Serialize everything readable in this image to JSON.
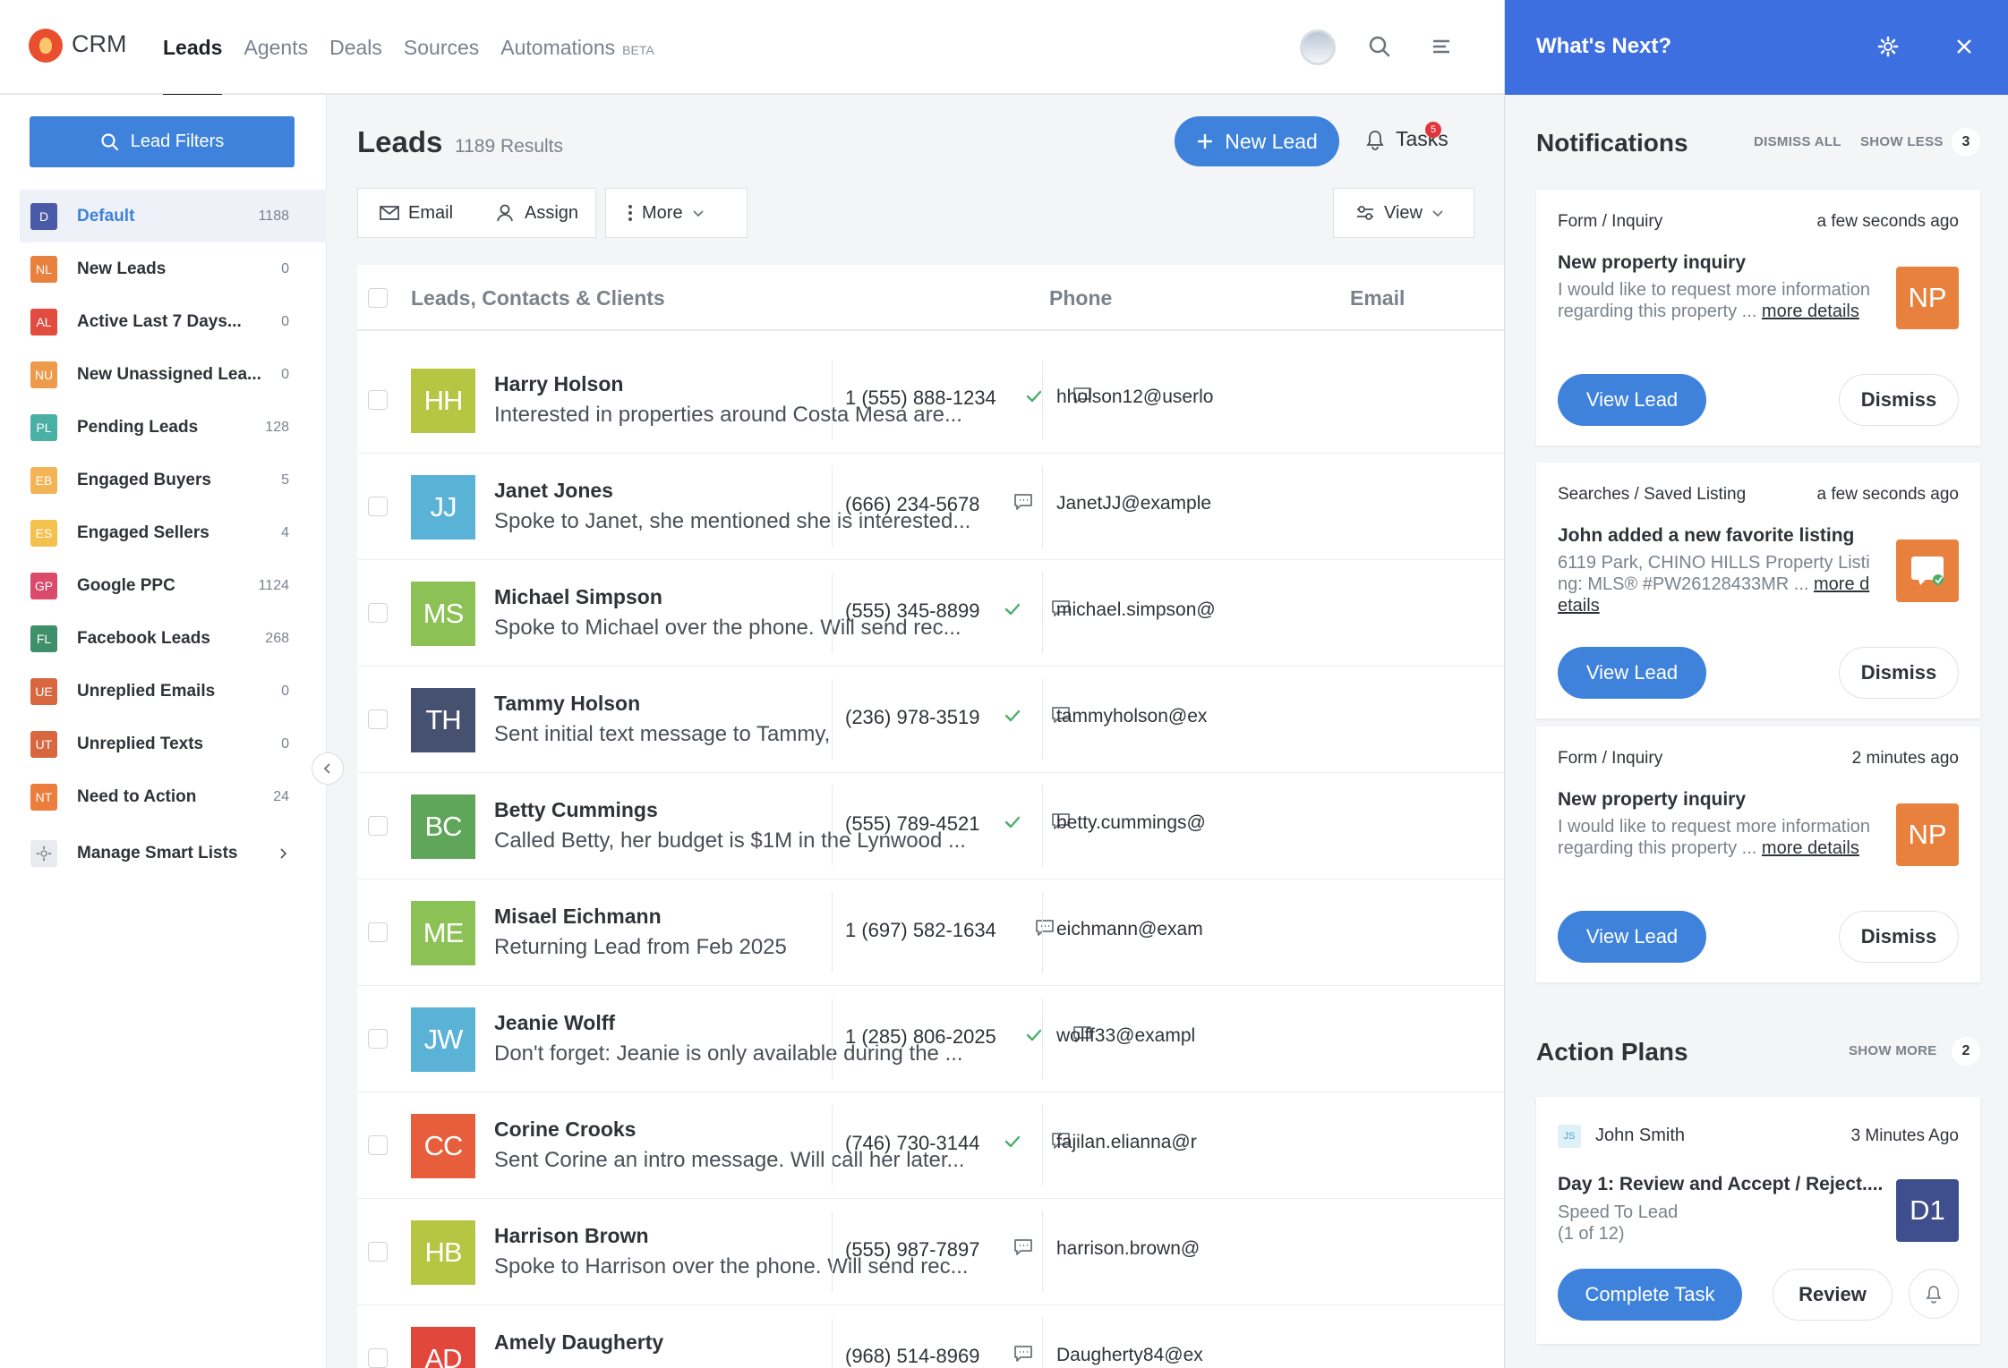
{
  "app": {
    "brand": "CRM"
  },
  "nav": [
    {
      "label": "Leads",
      "active": true
    },
    {
      "label": "Agents"
    },
    {
      "label": "Deals"
    },
    {
      "label": "Sources"
    },
    {
      "label": "Automations",
      "badge": "BETA"
    }
  ],
  "sidebar": {
    "filters_label": "Lead Filters",
    "items": [
      {
        "abbr": "D",
        "label": "Default",
        "count": "1188",
        "color": "#4b5aa6"
      },
      {
        "abbr": "NL",
        "label": "New Leads",
        "count": "0",
        "color": "#e8813e"
      },
      {
        "abbr": "AL",
        "label": "Active Last 7 Days...",
        "count": "0",
        "color": "#e24b3f"
      },
      {
        "abbr": "NU",
        "label": "New Unassigned Lea...",
        "count": "0",
        "color": "#ee9a4b"
      },
      {
        "abbr": "PL",
        "label": "Pending Leads",
        "count": "128",
        "color": "#4ab0a6"
      },
      {
        "abbr": "EB",
        "label": "Engaged Buyers",
        "count": "5",
        "color": "#f4b455"
      },
      {
        "abbr": "ES",
        "label": "Engaged Sellers",
        "count": "4",
        "color": "#f2c14e"
      },
      {
        "abbr": "GP",
        "label": "Google PPC",
        "count": "1124",
        "color": "#d94a6b"
      },
      {
        "abbr": "FL",
        "label": "Facebook Leads",
        "count": "268",
        "color": "#3f8f6a"
      },
      {
        "abbr": "UE",
        "label": "Unreplied Emails",
        "count": "0",
        "color": "#d8663e"
      },
      {
        "abbr": "UT",
        "label": "Unreplied Texts",
        "count": "0",
        "color": "#d8663e"
      },
      {
        "abbr": "NT",
        "label": "Need to Action",
        "count": "24",
        "color": "#ec7d3d"
      }
    ],
    "manage_label": "Manage Smart Lists"
  },
  "main": {
    "title": "Leads",
    "results": "1189 Results",
    "new_lead_label": "New Lead",
    "tasks_label": "Tasks",
    "tasks_count": "5",
    "toolbar": {
      "email": "Email",
      "assign": "Assign",
      "more": "More",
      "view": "View"
    },
    "columns": {
      "name": "Leads, Contacts & Clients",
      "phone": "Phone",
      "email": "Email"
    },
    "leads": [
      {
        "initials": "HH",
        "color": "#b6c542",
        "name": "Harry Holson",
        "note": "Interested in properties around Costa Mesa are...",
        "phone": "1 (555) 888-1234",
        "verified": true,
        "email": "hholson12@userlo"
      },
      {
        "initials": "JJ",
        "color": "#5ab3d6",
        "name": "Janet Jones",
        "note": "Spoke to Janet, she mentioned she is interested...",
        "phone": "(666) 234-5678",
        "verified": false,
        "email": "JanetJJ@example"
      },
      {
        "initials": "MS",
        "color": "#8cc156",
        "name": "Michael Simpson",
        "note": "Spoke to Michael over the phone. Will send rec...",
        "phone": "(555) 345-8899",
        "verified": true,
        "email": "michael.simpson@"
      },
      {
        "initials": "TH",
        "color": "#465071",
        "name": "Tammy Holson",
        "note": "Sent initial text message to Tammy,",
        "phone": "(236) 978-3519",
        "verified": true,
        "email": "tammyholson@ex"
      },
      {
        "initials": "BC",
        "color": "#5fa55a",
        "name": "Betty Cummings",
        "note": "Called Betty, her budget is $1M in the Lynwood ...",
        "phone": "(555) 789-4521",
        "verified": true,
        "email": "betty.cummings@"
      },
      {
        "initials": "ME",
        "color": "#8cc156",
        "name": "Misael Eichmann",
        "note": "Returning Lead from Feb 2025",
        "phone": "1 (697) 582-1634",
        "verified": false,
        "email": "eichmann@exam"
      },
      {
        "initials": "JW",
        "color": "#5ab3d6",
        "name": "Jeanie Wolff",
        "note": "Don't forget: Jeanie is only available during the ...",
        "phone": "1 (285) 806-2025",
        "verified": true,
        "email": "wolff33@exampl"
      },
      {
        "initials": "CC",
        "color": "#e65e3c",
        "name": "Corine Crooks",
        "note": "Sent Corine an intro message. Will call her later...",
        "phone": "(746) 730-3144",
        "verified": true,
        "email": "fajilan.elianna@r"
      },
      {
        "initials": "HB",
        "color": "#b6c542",
        "name": "Harrison Brown",
        "note": "Spoke to Harrison over the phone. Will send rec...",
        "phone": "(555) 987-7897",
        "verified": false,
        "email": "harrison.brown@"
      },
      {
        "initials": "AD",
        "color": "#e2473b",
        "name": "Amely Daugherty",
        "note": "",
        "phone": "(968) 514-8969",
        "verified": false,
        "email": "Daugherty84@ex"
      }
    ]
  },
  "panel": {
    "title": "What's Next?",
    "notifications": {
      "title": "Notifications",
      "dismiss_all": "DISMISS ALL",
      "show_less": "SHOW LESS",
      "count": "3",
      "items": [
        {
          "category": "Form / Inquiry",
          "time": "a few seconds ago",
          "title": "New property inquiry",
          "body": "I would like to request more information regarding this property ...",
          "more": "more details",
          "tile": "NP",
          "view_label": "View Lead",
          "dismiss_label": "Dismiss"
        },
        {
          "category": "Searches / Saved Listing",
          "time": "a few seconds ago",
          "title": "John added a new favorite listing",
          "body": "6119 Park, CHINO HILLS Property Listing: MLS® #PW26128433MR ...",
          "more": "more details",
          "tile": "",
          "view_label": "View Lead",
          "dismiss_label": "Dismiss"
        },
        {
          "category": "Form / Inquiry",
          "time": "2 minutes ago",
          "title": "New property inquiry",
          "body": "I would like to request more information regarding this property ...",
          "more": "more details",
          "tile": "NP",
          "view_label": "View Lead",
          "dismiss_label": "Dismiss"
        }
      ]
    },
    "action_plans": {
      "title": "Action Plans",
      "show_more": "SHOW MORE",
      "count": "2",
      "item": {
        "badge": "JS",
        "assignee": "John Smith",
        "time": "3 Minutes Ago",
        "title": "Day 1: Review and Accept / Reject....",
        "subtitle": "Speed To Lead",
        "progress": "(1 of 12)",
        "tile": "D1",
        "complete_label": "Complete Task",
        "review_label": "Review"
      }
    }
  }
}
